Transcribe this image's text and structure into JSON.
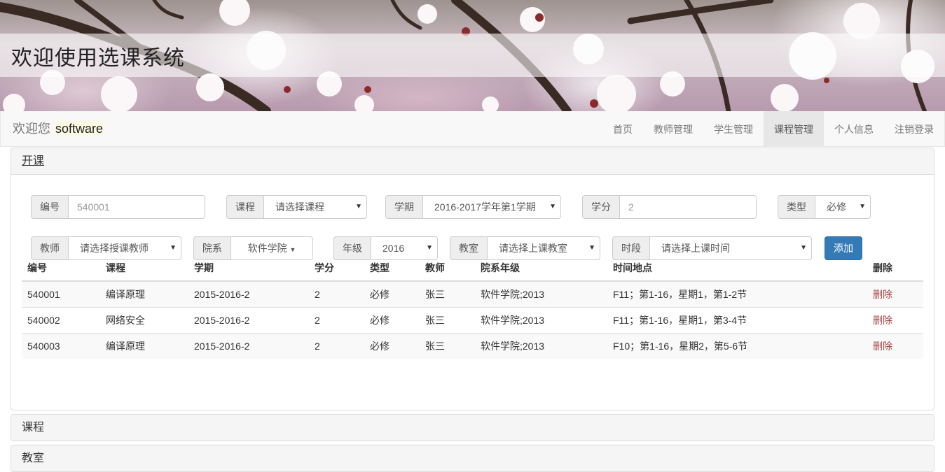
{
  "banner": {
    "title": "欢迎使用选课系统"
  },
  "navbar": {
    "greeting": "欢迎您",
    "username": "software",
    "menu": [
      {
        "label": "首页",
        "active": false
      },
      {
        "label": "教师管理",
        "active": false
      },
      {
        "label": "学生管理",
        "active": false
      },
      {
        "label": "课程管理",
        "active": true
      },
      {
        "label": "个人信息",
        "active": false
      },
      {
        "label": "注销登录",
        "active": false
      }
    ]
  },
  "open_course_panel": {
    "heading": "开课",
    "form": {
      "id": {
        "label": "编号",
        "value": "540001"
      },
      "course": {
        "label": "课程",
        "value": "请选择课程"
      },
      "term": {
        "label": "学期",
        "value": "2016-2017学年第1学期"
      },
      "credit": {
        "label": "学分",
        "value": "2"
      },
      "type": {
        "label": "类型",
        "value": "必修"
      },
      "teacher": {
        "label": "教师",
        "value": "请选择授课教师"
      },
      "department": {
        "label": "院系",
        "value": "软件学院"
      },
      "grade": {
        "label": "年级",
        "value": "2016"
      },
      "classroom": {
        "label": "教室",
        "value": "请选择上课教室"
      },
      "period": {
        "label": "时段",
        "value": "请选择上课时间"
      },
      "add_label": "添加"
    },
    "table": {
      "headers": [
        "编号",
        "课程",
        "学期",
        "学分",
        "类型",
        "教师",
        "院系年级",
        "时间地点",
        "删除"
      ],
      "rows": [
        {
          "id": "540001",
          "course": "编译原理",
          "term": "2015-2016-2",
          "credit": "2",
          "type": "必修",
          "teacher": "张三",
          "dept_grade": "软件学院;2013",
          "time_place": "F11；第1-16，星期1，第1-2节",
          "delete": "删除"
        },
        {
          "id": "540002",
          "course": "网络安全",
          "term": "2015-2016-2",
          "credit": "2",
          "type": "必修",
          "teacher": "张三",
          "dept_grade": "软件学院;2013",
          "time_place": "F11；第1-16，星期1，第3-4节",
          "delete": "删除"
        },
        {
          "id": "540003",
          "course": "编译原理",
          "term": "2015-2016-2",
          "credit": "2",
          "type": "必修",
          "teacher": "张三",
          "dept_grade": "软件学院;2013",
          "time_place": "F10；第1-16，星期2，第5-6节",
          "delete": "删除"
        }
      ]
    }
  },
  "course_panel": {
    "heading": "课程"
  },
  "classroom_panel": {
    "heading": "教室"
  }
}
